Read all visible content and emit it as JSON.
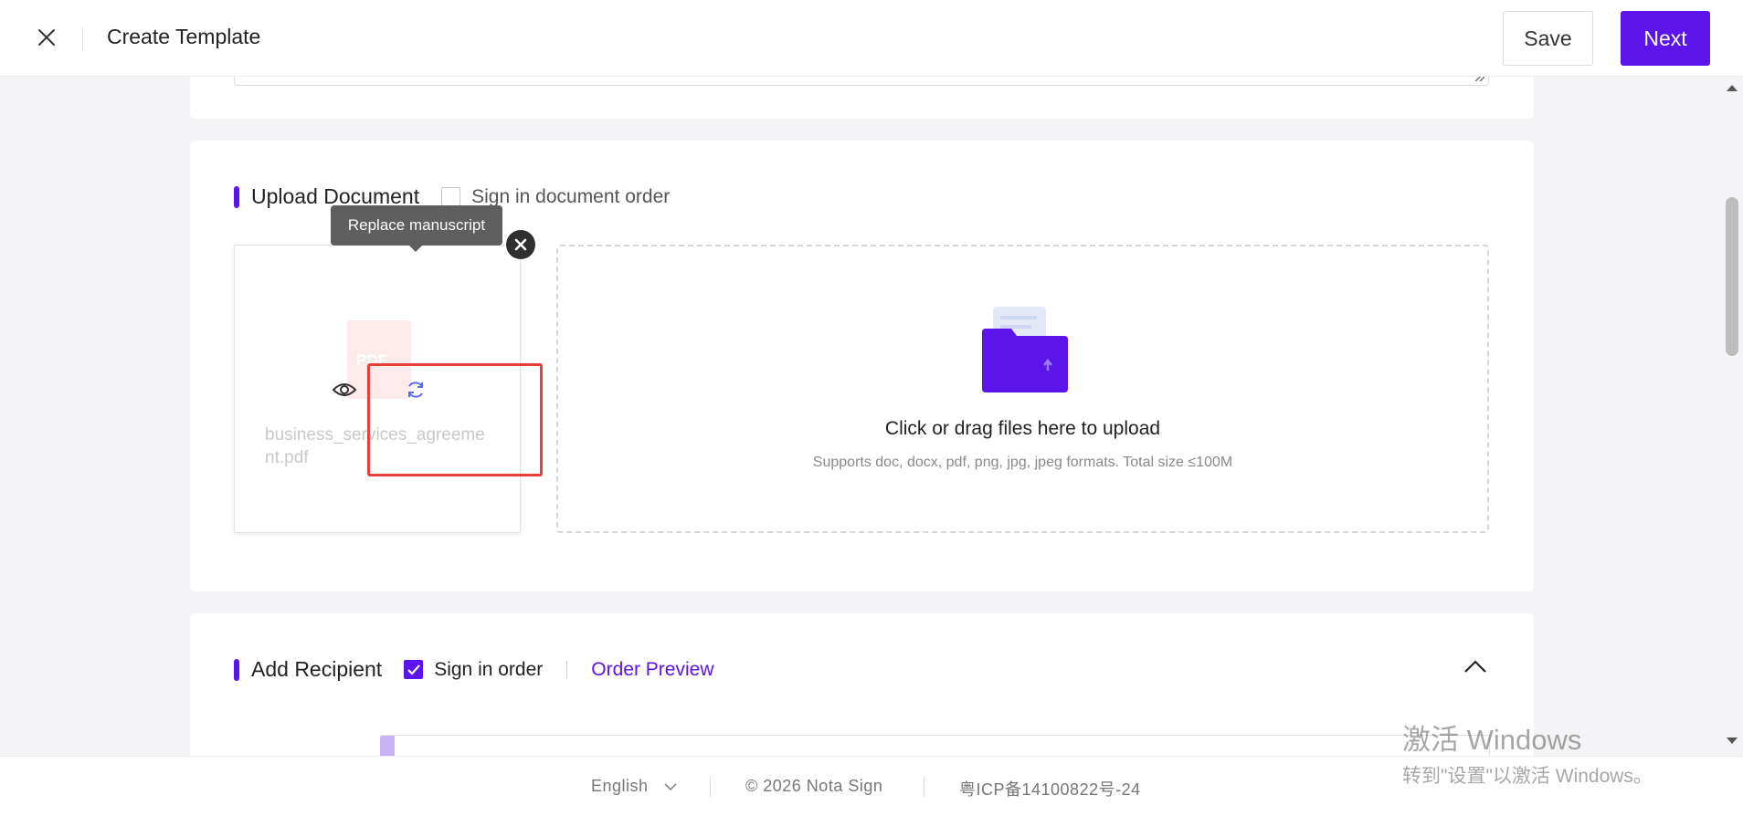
{
  "header": {
    "title": "Create Template",
    "save_label": "Save",
    "next_label": "Next"
  },
  "upload": {
    "title": "Upload Document",
    "sign_in_doc_order_label": "Sign in document order",
    "sign_in_doc_order_checked": false,
    "document": {
      "file_name": "business_services_agreement.pdf",
      "thumb_label": "PDF",
      "tooltip": "Replace manuscript"
    },
    "dropzone": {
      "title": "Click or drag files here to upload",
      "subtitle": "Supports doc, docx, pdf, png, jpg, jpeg formats. Total size ≤100M"
    }
  },
  "recipient": {
    "title": "Add Recipient",
    "sign_in_order_label": "Sign in order",
    "sign_in_order_checked": true,
    "order_preview_label": "Order Preview"
  },
  "footer": {
    "language": "English",
    "copyright": "© 2026 Nota Sign",
    "icp": "粤ICP备14100822号-24"
  },
  "watermark": {
    "line1": "激活 Windows",
    "line2": "转到\"设置\"以激活 Windows。"
  },
  "colors": {
    "accent": "#5b14ea",
    "highlight": "#e5413a"
  },
  "icons": {
    "close": "close-icon",
    "view": "eye-icon",
    "replace": "refresh-icon",
    "remove": "remove-icon",
    "upload": "folder-upload-icon",
    "collapse": "chevron-up-icon",
    "language": "chevron-down-icon"
  }
}
